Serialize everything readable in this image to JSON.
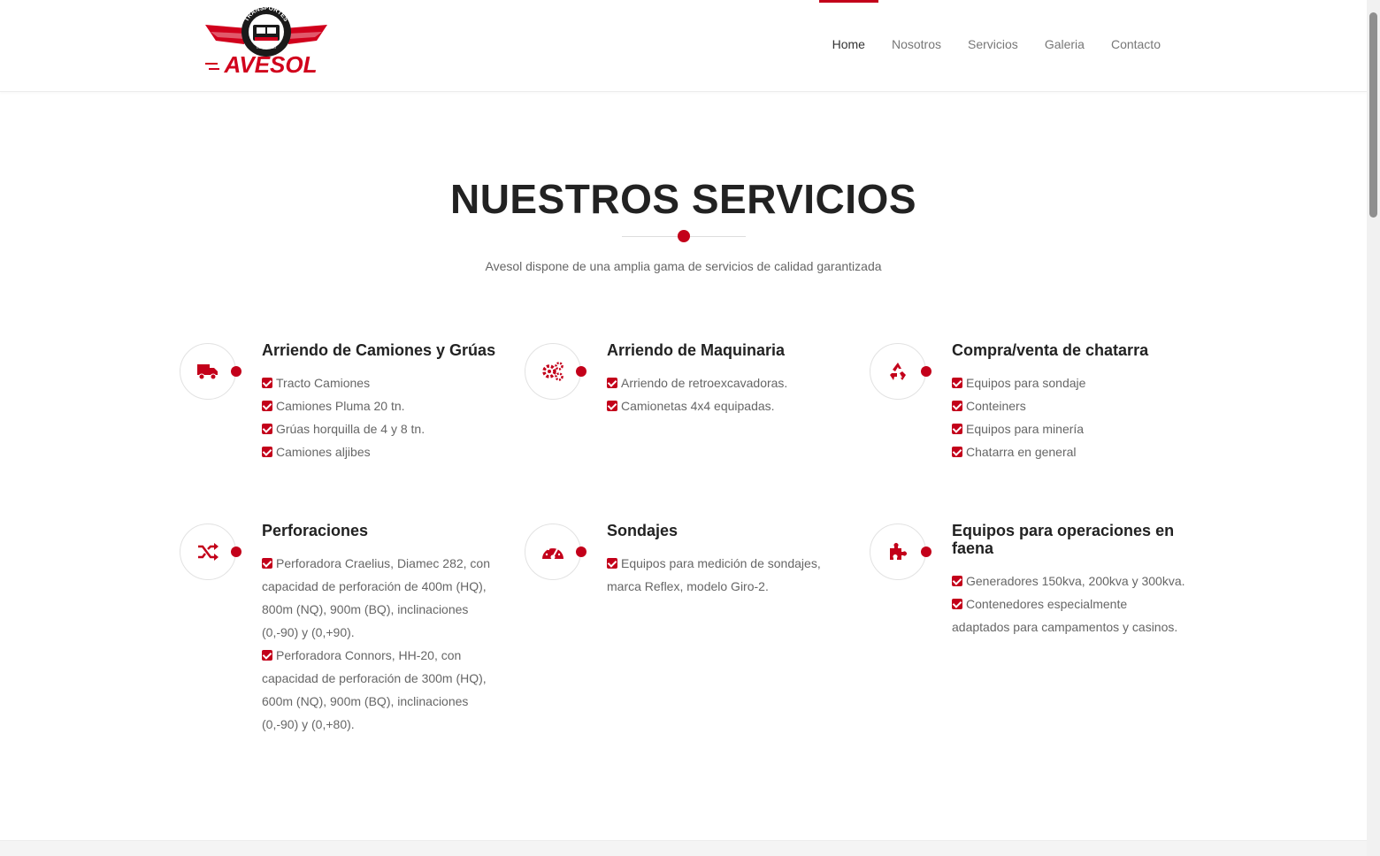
{
  "header": {
    "logo": {
      "top_text": "TRANSPORTES",
      "small_text": "COQUIMBO",
      "brand": "AVESOL"
    },
    "nav": [
      {
        "label": "Home",
        "active": true
      },
      {
        "label": "Nosotros",
        "active": false
      },
      {
        "label": "Servicios",
        "active": false
      },
      {
        "label": "Galeria",
        "active": false
      },
      {
        "label": "Contacto",
        "active": false
      }
    ]
  },
  "section": {
    "title": "NUESTROS SERVICIOS",
    "subtitle": "Avesol dispone de una amplia gama de servicios de calidad garantizada"
  },
  "services": [
    {
      "icon": "truck-icon",
      "title": "Arriendo de Camiones y Grúas",
      "items": [
        "Tracto Camiones",
        "Camiones Pluma 20 tn.",
        "Grúas horquilla de 4 y 8 tn.",
        "Camiones aljibes"
      ]
    },
    {
      "icon": "cogs-icon",
      "title": "Arriendo de Maquinaria",
      "items": [
        "Arriendo de retroexcavadoras.",
        "Camionetas 4x4 equipadas."
      ]
    },
    {
      "icon": "recycle-icon",
      "title": "Compra/venta de chatarra",
      "items": [
        "Equipos para sondaje",
        "Conteiners",
        "Equipos para minería",
        "Chatarra en general"
      ]
    },
    {
      "icon": "shuffle-icon",
      "title": "Perforaciones",
      "items": [
        [
          "Perforadora Craelius, Diamec 282, con",
          "capacidad de perforación de 400m (HQ),",
          "800m (NQ), 900m (BQ), inclinaciones",
          "(0,-90) y (0,+90)."
        ],
        [
          "Perforadora Connors, HH-20, con",
          "capacidad de perforación de 300m (HQ),",
          "600m (NQ), 900m (BQ), inclinaciones",
          "(0,-90) y (0,+80)."
        ]
      ]
    },
    {
      "icon": "dashboard-icon",
      "title": "Sondajes",
      "items": [
        [
          "Equipos para medición de sondajes,",
          "marca Reflex, modelo Giro-2."
        ]
      ]
    },
    {
      "icon": "puzzle-icon",
      "title": [
        "Equipos para operaciones en",
        "faena"
      ],
      "items": [
        [
          "Generadores 150kva, 200kva y 300kva."
        ],
        [
          "Contenedores especialmente",
          "adaptados para campamentos y casinos."
        ]
      ]
    }
  ],
  "colors": {
    "accent": "#c3001a",
    "heading": "#222222",
    "text": "#666666",
    "nav_text": "#777777"
  }
}
